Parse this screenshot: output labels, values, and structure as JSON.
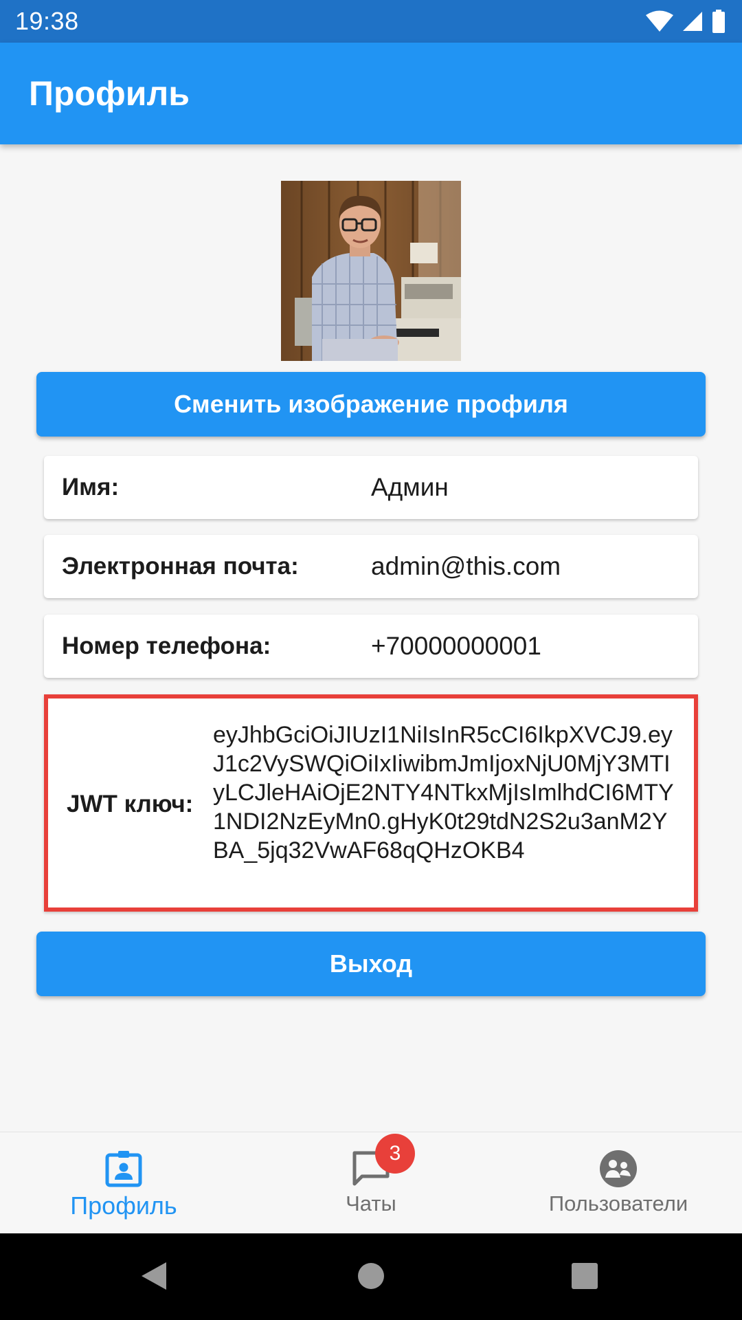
{
  "status_bar": {
    "time": "19:38"
  },
  "app_bar": {
    "title": "Профиль"
  },
  "profile": {
    "avatar_icon": "profile-photo",
    "change_image_label": "Сменить изображение профиля",
    "fields": [
      {
        "label": "Имя:",
        "value": "Админ"
      },
      {
        "label": "Электронная почта:",
        "value": "admin@this.com"
      },
      {
        "label": "Номер телефона:",
        "value": "+70000000001"
      }
    ],
    "jwt": {
      "label": "JWT ключ:",
      "value": "eyJhbGciOiJIUzI1NiIsInR5cCI6IkpXVCJ9.eyJ1c2VySWQiOiIxIiwibmJmIjoxNjU0MjY3MTIyLCJleHAiOjE2NTY4NTkxMjIsImlhdCI6MTY1NDI2NzEyMn0.gHyK0t29tdN2S2u3anM2YBA_5jq32VwAF68qQHzOKB4"
    },
    "logout_label": "Выход"
  },
  "bottom_nav": {
    "items": [
      {
        "label": "Профиль",
        "icon": "profile-badge-icon",
        "active": true
      },
      {
        "label": "Чаты",
        "icon": "chat-bubble-icon",
        "badge": "3"
      },
      {
        "label": "Пользователи",
        "icon": "users-group-icon"
      }
    ]
  },
  "colors": {
    "status_bar": "#1f72c6",
    "primary": "#2194f3",
    "highlight_border": "#e8403a",
    "badge": "#e8403a"
  }
}
